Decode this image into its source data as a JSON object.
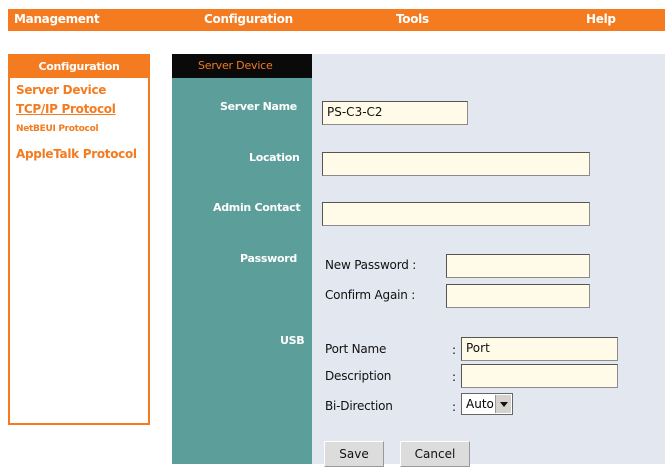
{
  "topnav": {
    "management": "Management",
    "configuration": "Configuration",
    "tools": "Tools",
    "help": "Help"
  },
  "sidebar": {
    "header": "Configuration",
    "items": [
      {
        "label": "Server Device"
      },
      {
        "label": "TCP/IP Protocol"
      },
      {
        "label": "NetBEUI Protocol"
      },
      {
        "label": "AppleTalk Protocol"
      }
    ]
  },
  "panel": {
    "title": "Server Device",
    "server_name_label": "Server Name",
    "server_name_value": "PS-C3-C2",
    "location_label": "Location",
    "location_value": "",
    "admin_contact_label": "Admin Contact",
    "admin_contact_value": "",
    "password_label": "Password",
    "new_password_label": "New Password :",
    "new_password_value": "",
    "confirm_again_label": "Confirm Again :",
    "confirm_again_value": "",
    "usb_label": "USB",
    "port_name_label": "Port Name",
    "port_name_value": "Port",
    "description_label": "Description",
    "description_value": "",
    "bidirection_label": "Bi-Direction",
    "bidirection_value": "Auto",
    "colon": ":",
    "save_label": "Save",
    "cancel_label": "Cancel"
  },
  "colors": {
    "accent": "#f47b20",
    "teal": "#5c9e9a",
    "panel_bg": "#e3e7ef"
  }
}
